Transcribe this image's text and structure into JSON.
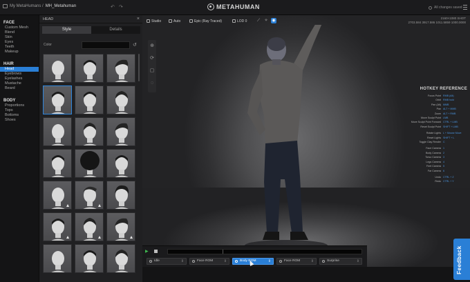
{
  "topbar": {
    "breadcrumb_root": "My MetaHumans /",
    "breadcrumb_current": "MH_Metahuman",
    "logo_text": "METAHUMAN",
    "saved_status": "All changes saved"
  },
  "nav": {
    "face_title": "FACE",
    "face_items": [
      "Custom Mesh",
      "Blend",
      "Skin",
      "Eyes",
      "Teeth",
      "Makeup"
    ],
    "hair_title": "HAIR",
    "hair_items": [
      "Head",
      "Eyebrows",
      "Eyelashes",
      "Mustache",
      "Beard"
    ],
    "body_title": "BODY",
    "body_items": [
      "Proportions",
      "Tops",
      "Bottoms",
      "Shoes"
    ],
    "active_item": "Head"
  },
  "panel": {
    "title": "HEAD",
    "tab_style": "Style",
    "tab_details": "Details",
    "color_label": "Color",
    "colors": {
      "accent": "#2a7fd6",
      "tile": "#555558"
    }
  },
  "viewport": {
    "toolbar": {
      "studio": "Studio",
      "auto": "Auto",
      "quality": "Epic (Ray Traced)",
      "lod": "LOD 0"
    },
    "stats_line1": "2160×1080 SHOT",
    "stats_line2": "2703.584 3917.586 1011.5859 1000.0000",
    "hotkeys": {
      "title": "HOTKEY REFERENCE",
      "rows": [
        {
          "action": "Focus Point",
          "key": "RMB (Alt)"
        },
        {
          "action": "Orbit",
          "key": "RMB hold"
        },
        {
          "action": "Pan (Alt)",
          "key": "MMB"
        },
        {
          "action": "Pan",
          "key": "ALT + MMB"
        },
        {
          "action": "Zoom",
          "key": "ALT + RMB"
        },
        {
          "action": "Move Sculpt Point",
          "key": "LMB"
        },
        {
          "action": "Move Sculpt Point Forward",
          "key": "CTRL + LMB"
        },
        {
          "action": "Reset Sculpt Point",
          "key": "SHIFT + LMB"
        },
        {
          "action": "Rotate Lights",
          "key": "L + Mouse Move"
        },
        {
          "action": "Reset Lights",
          "key": "SHIFT + L"
        },
        {
          "action": "Toggle Clay Render",
          "key": "C"
        },
        {
          "action": "Face Camera",
          "key": "1"
        },
        {
          "action": "Body Camera",
          "key": "2"
        },
        {
          "action": "Torso Camera",
          "key": "3"
        },
        {
          "action": "Legs Camera",
          "key": "4"
        },
        {
          "action": "Feet Camera",
          "key": "5"
        },
        {
          "action": "Far Camera",
          "key": "6"
        },
        {
          "action": "Undo",
          "key": "CTRL + Z"
        },
        {
          "action": "Redo",
          "key": "CTRL + Y"
        }
      ]
    }
  },
  "timeline": {
    "anims": [
      {
        "label": "Idle",
        "active": false
      },
      {
        "label": "Face ROM",
        "active": false
      },
      {
        "label": "Body ROM",
        "active": true
      },
      {
        "label": "Face ROM",
        "active": false
      },
      {
        "label": "Surprise",
        "active": false
      }
    ]
  },
  "feedback_label": "Feedback"
}
